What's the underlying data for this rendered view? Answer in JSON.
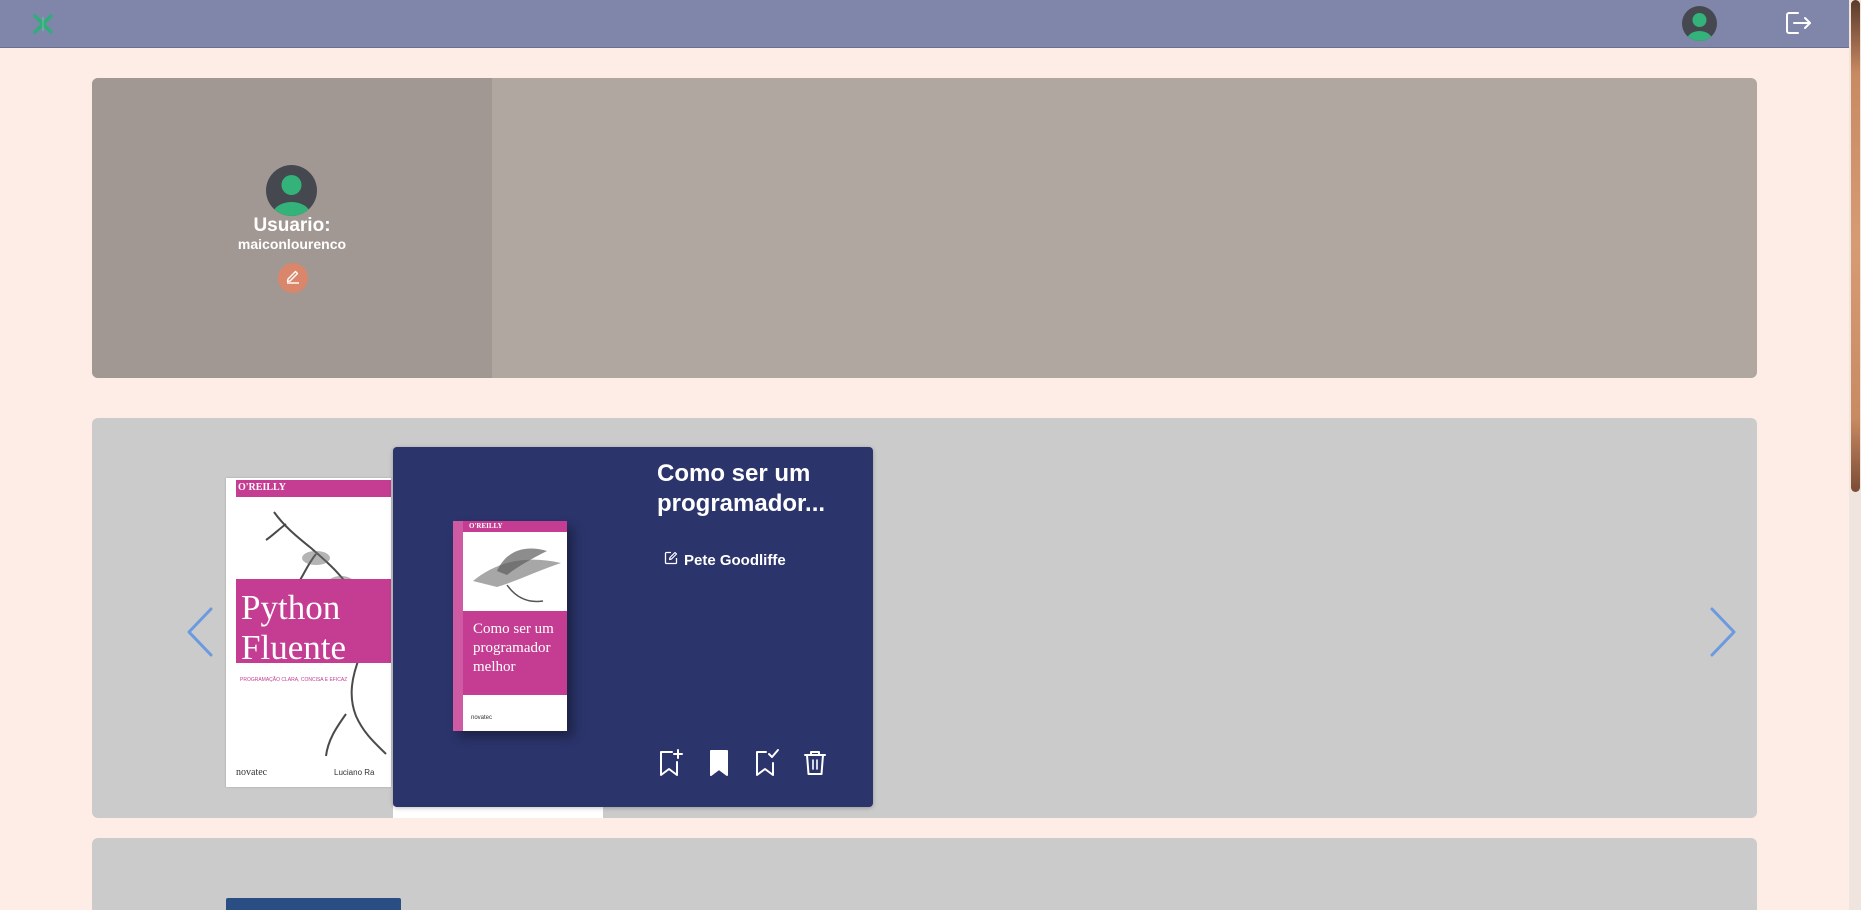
{
  "app": {
    "header": {
      "logo_icon": "x-logo-icon",
      "avatar_icon": "user-avatar-icon",
      "logout_icon": "logout-icon"
    }
  },
  "profile": {
    "label": "Usuario:",
    "username": "maiconlourenco",
    "edit_icon": "pencil-icon"
  },
  "carousel": {
    "prev_icon": "chevron-left-icon",
    "next_icon": "chevron-right-icon",
    "books": [
      {
        "cover_publisher": "O'REILLY",
        "cover_title_line1": "Python",
        "cover_title_line2": "Fluente",
        "cover_subtitle": "PROGRAMAÇÃO CLARA, CONCISA E EFICAZ",
        "cover_imprint": "novatec",
        "cover_author": "Luciano Ra"
      }
    ],
    "active_card": {
      "title": "Como ser um programador...",
      "author": "Pete Goodliffe",
      "cover_publisher": "O'REILLY",
      "cover_title_line1": "Como ser um",
      "cover_title_line2": "programador",
      "cover_title_line3": "melhor",
      "cover_imprint": "novatec",
      "actions": [
        {
          "icon": "bookmark-plus-icon"
        },
        {
          "icon": "bookmark-filled-icon"
        },
        {
          "icon": "bookmark-check-icon"
        },
        {
          "icon": "trash-icon"
        }
      ]
    }
  },
  "colors": {
    "page_bg": "#fdede6",
    "topbar": "#7f86aa",
    "card_bg": "#2b346b",
    "accent_pink": "#c43d92",
    "edit_button": "#d9866a",
    "nav_arrow": "#6b9ae0"
  }
}
